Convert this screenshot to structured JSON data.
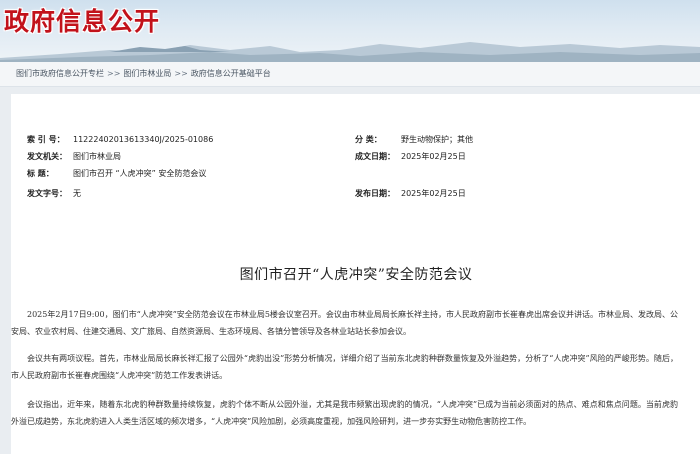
{
  "header": {
    "site_title": "政府信息公开"
  },
  "breadcrumb": {
    "items": [
      "图们市政府信息公开专栏",
      "图们市林业局",
      "政府信息公开基础平台"
    ],
    "separator": ">>"
  },
  "meta": {
    "index_label": "索 引 号：",
    "index_value": "11222402013613340J/2025-01086",
    "category_label": "分 类：",
    "category_value": "野生动物保护；其他",
    "publisher_label": "发文机关：",
    "publisher_value": "图们市林业局",
    "created_label": "成文日期：",
    "created_value": "2025年02月25日",
    "title_label": "标 题：",
    "title_value": "图们市召开 “人虎冲突” 安全防范会议",
    "docno_label": "发文字号：",
    "docno_value": "无",
    "published_label": "发布日期：",
    "published_value": "2025年02月25日"
  },
  "article": {
    "title": "图们市召开“人虎冲突”安全防范会议",
    "paragraphs": [
      "2025年2月17日9:00，图们市“人虎冲突”安全防范会议在市林业局5楼会议室召开。会议由市林业局局长麻长祥主持，市人民政府副市长崔春虎出席会议并讲话。市林业局、发改局、公安局、农业农村局、住建交通局、文广旅局、自然资源局、生态环境局、各镇分管领导及各林业站站长参加会议。",
      "会议共有两项议程。首先，市林业局局长麻长祥汇报了公园外“虎豹出没”形势分析情况，详细介绍了当前东北虎豹种群数量恢复及外溢趋势，分析了“人虎冲突”风险的严峻形势。随后，市人民政府副市长崔春虎围绕“人虎冲突”防范工作发表讲话。",
      "会议指出，近年来，随着东北虎豹种群数量持续恢复，虎豹个体不断从公园外溢，尤其是我市频繁出现虎豹的情况，“人虎冲突”已成为当前必须面对的热点、难点和焦点问题。当前虎豹外溢已成趋势，东北虎豹进入人类生活区域的频次增多，“人虎冲突”风险加剧，必须高度重视，加强风险研判，进一步夯实野生动物危害防控工作。"
    ]
  }
}
